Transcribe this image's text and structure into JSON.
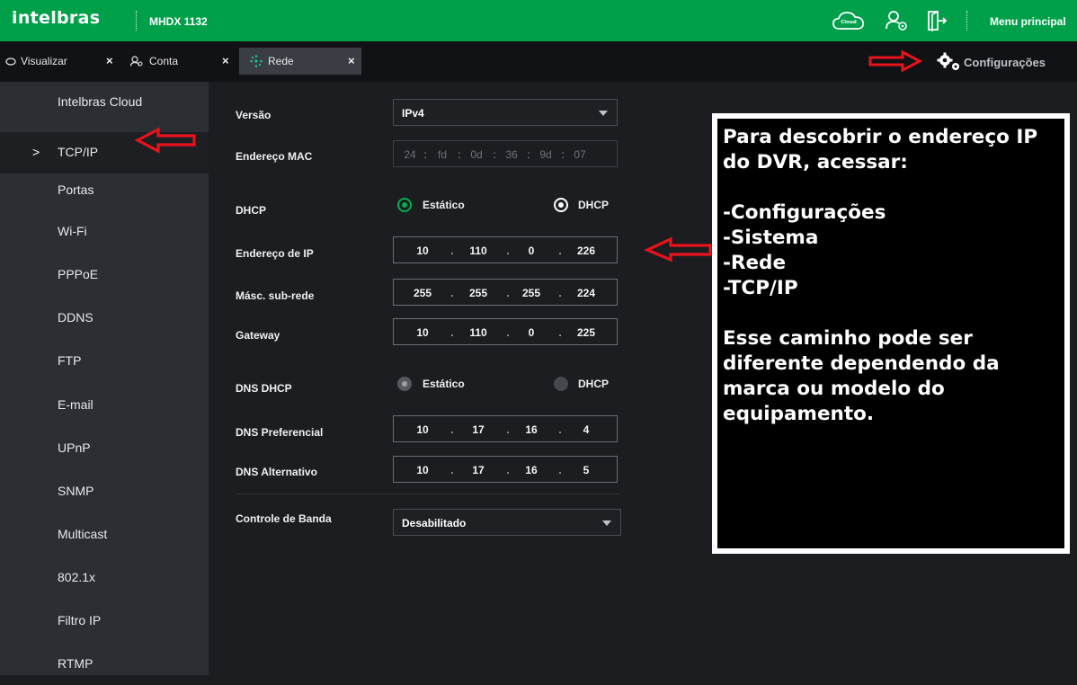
{
  "header": {
    "logo": "intelbras",
    "model": "MHDX 1132",
    "cloud_badge": "Intelbras Cloud",
    "main_menu_label": "Menu principal",
    "accent_color": "#00a04a"
  },
  "tabs": [
    {
      "label": "Visualizar",
      "icon": "eye-icon",
      "close": "×"
    },
    {
      "label": "Conta",
      "icon": "users-icon",
      "close": "×"
    },
    {
      "label": "Rede",
      "icon": "network-icon",
      "close": "×",
      "active": true
    }
  ],
  "settings_link": {
    "label": "Configurações",
    "icon": "gears-icon"
  },
  "sidebar": {
    "items": [
      {
        "label": "Intelbras Cloud"
      },
      {
        "label": "TCP/IP",
        "active": true,
        "marker": ">"
      },
      {
        "label": "Portas"
      },
      {
        "label": "Wi-Fi"
      },
      {
        "label": "PPPoE"
      },
      {
        "label": "DDNS"
      },
      {
        "label": "FTP"
      },
      {
        "label": "E-mail"
      },
      {
        "label": "UPnP"
      },
      {
        "label": "SNMP"
      },
      {
        "label": "Multicast"
      },
      {
        "label": "802.1x"
      },
      {
        "label": "Filtro IP"
      },
      {
        "label": "RTMP"
      }
    ]
  },
  "form": {
    "version": {
      "label": "Versão",
      "value": "IPv4"
    },
    "mac": {
      "label": "Endereço MAC",
      "octets": [
        "24",
        "fd",
        "0d",
        "36",
        "9d",
        "07"
      ],
      "sep": ":"
    },
    "dhcp": {
      "label": "DHCP",
      "option_static": "Estático",
      "option_dhcp": "DHCP",
      "selected": "Estático"
    },
    "ip": {
      "label": "Endereço de IP",
      "octets": [
        "10",
        "110",
        "0",
        "226"
      ]
    },
    "mask": {
      "label": "Másc. sub-rede",
      "octets": [
        "255",
        "255",
        "255",
        "224"
      ]
    },
    "gateway": {
      "label": "Gateway",
      "octets": [
        "10",
        "110",
        "0",
        "225"
      ]
    },
    "dns_dhcp": {
      "label": "DNS DHCP",
      "option_static": "Estático",
      "option_dhcp": "DHCP",
      "selected": "Estático"
    },
    "dns_pref": {
      "label": "DNS Preferencial",
      "octets": [
        "10",
        "17",
        "16",
        "4"
      ]
    },
    "dns_alt": {
      "label": "DNS Alternativo",
      "octets": [
        "10",
        "17",
        "16",
        "5"
      ]
    },
    "bandwidth": {
      "label": "Controle de Banda",
      "value": "Desabilitado"
    },
    "ip_sep": "."
  },
  "note": {
    "lines": [
      "Para descobrir o endereço IP",
      "do DVR, acessar:",
      "",
      "-Configurações",
      "-Sistema",
      "-Rede",
      "-TCP/IP",
      "",
      "Esse caminho pode ser",
      "diferente dependendo da",
      "marca ou modelo do",
      "equipamento."
    ]
  },
  "annotation_color": "#e8131b"
}
